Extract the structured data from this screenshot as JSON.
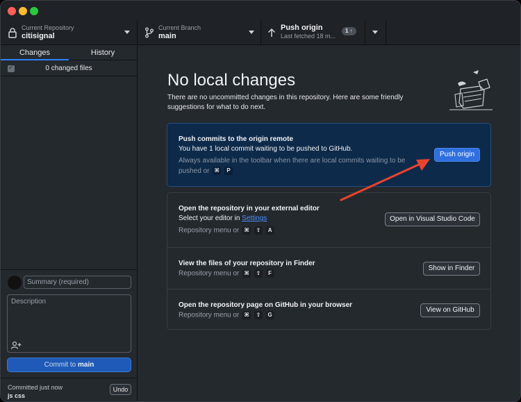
{
  "toolbar": {
    "repo": {
      "label": "Current Repository",
      "value": "citisignal"
    },
    "branch": {
      "label": "Current Branch",
      "value": "main"
    },
    "push": {
      "label": "Push origin",
      "sub": "Last fetched 18 m...",
      "badge": "1 ↑"
    }
  },
  "sidebar": {
    "tabs": [
      {
        "label": "Changes"
      },
      {
        "label": "History"
      }
    ],
    "changed_files": "0 changed files",
    "summary_placeholder": "Summary (required)",
    "description_placeholder": "Description",
    "commit_prefix": "Commit to ",
    "commit_branch": "main",
    "last_commit": {
      "time": "Committed just now",
      "message": "js css",
      "undo": "Undo"
    }
  },
  "main": {
    "title": "No local changes",
    "subtitle": "There are no uncommitted changes in this repository. Here are some friendly suggestions for what to do next.",
    "push_card": {
      "title": "Push commits to the origin remote",
      "desc": "You have 1 local commit waiting to be pushed to GitHub.",
      "hint": "Always available in the toolbar when there are local commits waiting to be pushed or",
      "keys": [
        "⌘",
        "P"
      ],
      "button": "Push origin"
    },
    "editor_card": {
      "title": "Open the repository in your external editor",
      "desc_prefix": "Select your editor in ",
      "desc_link": "Settings",
      "hint": "Repository menu or",
      "keys": [
        "⌘",
        "⇧",
        "A"
      ],
      "button": "Open in Visual Studio Code"
    },
    "finder_card": {
      "title": "View the files of your repository in Finder",
      "hint": "Repository menu or",
      "keys": [
        "⌘",
        "⇧",
        "F"
      ],
      "button": "Show in Finder"
    },
    "github_card": {
      "title": "Open the repository page on GitHub in your browser",
      "hint": "Repository menu or",
      "keys": [
        "⌘",
        "⇧",
        "G"
      ],
      "button": "View on GitHub"
    }
  },
  "colors": {
    "accent": "#2f6fdf",
    "arrow": "#e8432e",
    "push_card_bg": "#0e2a4a",
    "background": "#24292e"
  }
}
